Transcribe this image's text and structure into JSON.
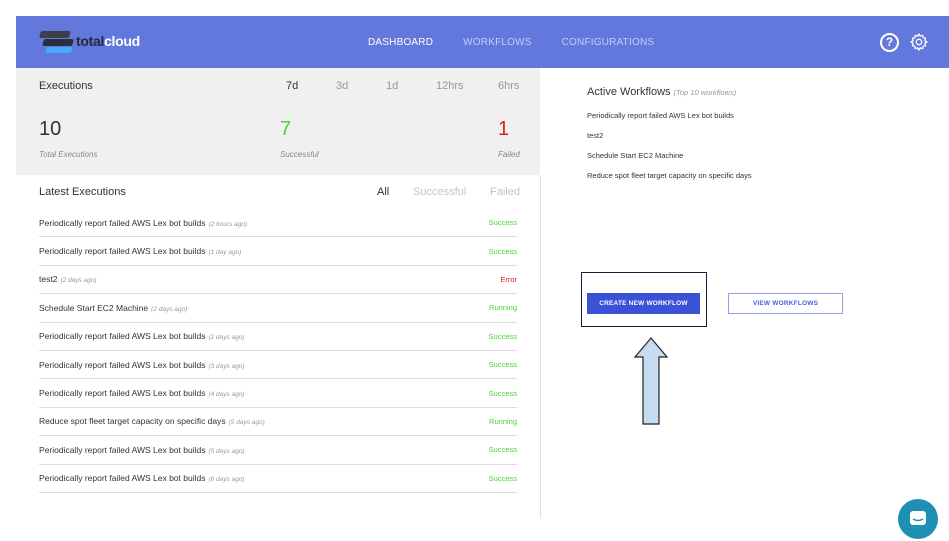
{
  "header": {
    "logo_part1": "total",
    "logo_part2": "cloud",
    "nav": [
      {
        "label": "DASHBOARD",
        "active": true
      },
      {
        "label": "WORKFLOWS",
        "active": false
      },
      {
        "label": "CONFIGURATIONS",
        "active": false
      }
    ],
    "help_icon": "help-circle-icon",
    "settings_icon": "gear-icon"
  },
  "stats": {
    "title": "Executions",
    "ranges": [
      {
        "label": "7d",
        "active": true
      },
      {
        "label": "3d",
        "active": false
      },
      {
        "label": "1d",
        "active": false
      },
      {
        "label": "12hrs",
        "active": false
      },
      {
        "label": "6hrs",
        "active": false
      }
    ],
    "total": {
      "value": "10",
      "label": "Total Executions",
      "color": "#333333"
    },
    "successful": {
      "value": "7",
      "label": "Successful",
      "color": "#4cd137"
    },
    "failed": {
      "value": "1",
      "label": "Failed",
      "color": "#e02020"
    }
  },
  "latest": {
    "title": "Latest Executions",
    "filters": [
      {
        "label": "All",
        "active": true
      },
      {
        "label": "Successful",
        "active": false
      },
      {
        "label": "Failed",
        "active": false
      }
    ],
    "rows": [
      {
        "name": "Periodically report failed AWS Lex bot builds",
        "time": "(2 hours ago)",
        "status": "Success"
      },
      {
        "name": "Periodically report failed AWS Lex bot builds",
        "time": "(1 day ago)",
        "status": "Success"
      },
      {
        "name": "test2",
        "time": "(2 days ago)",
        "status": "Error"
      },
      {
        "name": "Schedule Start EC2 Machine",
        "time": "(2 days ago)",
        "status": "Running"
      },
      {
        "name": "Periodically report failed AWS Lex bot builds",
        "time": "(2 days ago)",
        "status": "Success"
      },
      {
        "name": "Periodically report failed AWS Lex bot builds",
        "time": "(3 days ago)",
        "status": "Success"
      },
      {
        "name": "Periodically report failed AWS Lex bot builds",
        "time": "(4 days ago)",
        "status": "Success"
      },
      {
        "name": "Reduce spot fleet target capacity on specific days",
        "time": "(5 days ago)",
        "status": "Running"
      },
      {
        "name": "Periodically report failed AWS Lex bot builds",
        "time": "(5 days ago)",
        "status": "Success"
      },
      {
        "name": "Periodically report failed AWS Lex bot builds",
        "time": "(6 days ago)",
        "status": "Success"
      }
    ],
    "status_colors": {
      "Success": "#4cd137",
      "Running": "#4cd137",
      "Error": "#e02020"
    }
  },
  "active_workflows": {
    "title": "Active Workflows",
    "subtitle": "(Top 10 workflows)",
    "items": [
      "Periodically report failed AWS Lex bot builds",
      "test2",
      "Schedule Start EC2 Machine",
      "Reduce spot fleet target capacity on specific days"
    ]
  },
  "buttons": {
    "create": "CREATE NEW WORKFLOW",
    "view": "VIEW WORKFLOWS"
  },
  "annotation": {
    "arrow_icon": "up-arrow-icon",
    "arrow_color": "#c6dcf0"
  },
  "chat_icon": "chat-icon",
  "colors": {
    "header_bg": "#6378dd",
    "primary": "#3a52d6",
    "stats_bg": "#f0f0f0"
  }
}
